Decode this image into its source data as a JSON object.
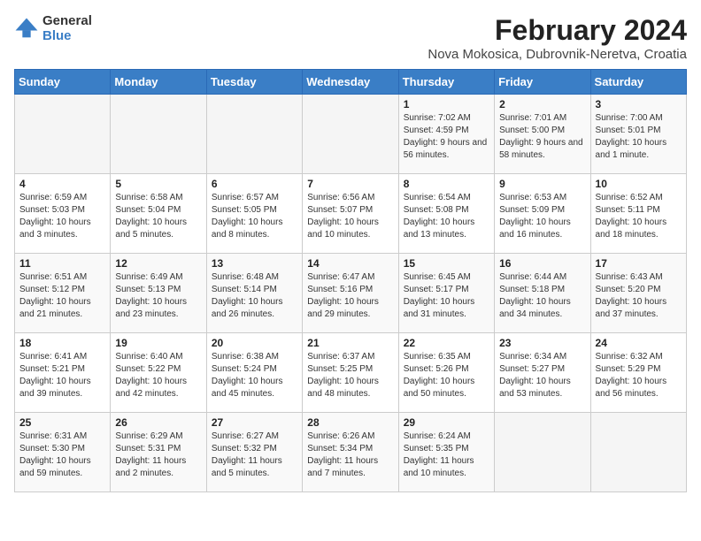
{
  "logo": {
    "general": "General",
    "blue": "Blue"
  },
  "title": "February 2024",
  "subtitle": "Nova Mokosica, Dubrovnik-Neretva, Croatia",
  "headers": [
    "Sunday",
    "Monday",
    "Tuesday",
    "Wednesday",
    "Thursday",
    "Friday",
    "Saturday"
  ],
  "rows": [
    [
      {
        "day": "",
        "info": ""
      },
      {
        "day": "",
        "info": ""
      },
      {
        "day": "",
        "info": ""
      },
      {
        "day": "",
        "info": ""
      },
      {
        "day": "1",
        "info": "Sunrise: 7:02 AM\nSunset: 4:59 PM\nDaylight: 9 hours and 56 minutes."
      },
      {
        "day": "2",
        "info": "Sunrise: 7:01 AM\nSunset: 5:00 PM\nDaylight: 9 hours and 58 minutes."
      },
      {
        "day": "3",
        "info": "Sunrise: 7:00 AM\nSunset: 5:01 PM\nDaylight: 10 hours and 1 minute."
      }
    ],
    [
      {
        "day": "4",
        "info": "Sunrise: 6:59 AM\nSunset: 5:03 PM\nDaylight: 10 hours and 3 minutes."
      },
      {
        "day": "5",
        "info": "Sunrise: 6:58 AM\nSunset: 5:04 PM\nDaylight: 10 hours and 5 minutes."
      },
      {
        "day": "6",
        "info": "Sunrise: 6:57 AM\nSunset: 5:05 PM\nDaylight: 10 hours and 8 minutes."
      },
      {
        "day": "7",
        "info": "Sunrise: 6:56 AM\nSunset: 5:07 PM\nDaylight: 10 hours and 10 minutes."
      },
      {
        "day": "8",
        "info": "Sunrise: 6:54 AM\nSunset: 5:08 PM\nDaylight: 10 hours and 13 minutes."
      },
      {
        "day": "9",
        "info": "Sunrise: 6:53 AM\nSunset: 5:09 PM\nDaylight: 10 hours and 16 minutes."
      },
      {
        "day": "10",
        "info": "Sunrise: 6:52 AM\nSunset: 5:11 PM\nDaylight: 10 hours and 18 minutes."
      }
    ],
    [
      {
        "day": "11",
        "info": "Sunrise: 6:51 AM\nSunset: 5:12 PM\nDaylight: 10 hours and 21 minutes."
      },
      {
        "day": "12",
        "info": "Sunrise: 6:49 AM\nSunset: 5:13 PM\nDaylight: 10 hours and 23 minutes."
      },
      {
        "day": "13",
        "info": "Sunrise: 6:48 AM\nSunset: 5:14 PM\nDaylight: 10 hours and 26 minutes."
      },
      {
        "day": "14",
        "info": "Sunrise: 6:47 AM\nSunset: 5:16 PM\nDaylight: 10 hours and 29 minutes."
      },
      {
        "day": "15",
        "info": "Sunrise: 6:45 AM\nSunset: 5:17 PM\nDaylight: 10 hours and 31 minutes."
      },
      {
        "day": "16",
        "info": "Sunrise: 6:44 AM\nSunset: 5:18 PM\nDaylight: 10 hours and 34 minutes."
      },
      {
        "day": "17",
        "info": "Sunrise: 6:43 AM\nSunset: 5:20 PM\nDaylight: 10 hours and 37 minutes."
      }
    ],
    [
      {
        "day": "18",
        "info": "Sunrise: 6:41 AM\nSunset: 5:21 PM\nDaylight: 10 hours and 39 minutes."
      },
      {
        "day": "19",
        "info": "Sunrise: 6:40 AM\nSunset: 5:22 PM\nDaylight: 10 hours and 42 minutes."
      },
      {
        "day": "20",
        "info": "Sunrise: 6:38 AM\nSunset: 5:24 PM\nDaylight: 10 hours and 45 minutes."
      },
      {
        "day": "21",
        "info": "Sunrise: 6:37 AM\nSunset: 5:25 PM\nDaylight: 10 hours and 48 minutes."
      },
      {
        "day": "22",
        "info": "Sunrise: 6:35 AM\nSunset: 5:26 PM\nDaylight: 10 hours and 50 minutes."
      },
      {
        "day": "23",
        "info": "Sunrise: 6:34 AM\nSunset: 5:27 PM\nDaylight: 10 hours and 53 minutes."
      },
      {
        "day": "24",
        "info": "Sunrise: 6:32 AM\nSunset: 5:29 PM\nDaylight: 10 hours and 56 minutes."
      }
    ],
    [
      {
        "day": "25",
        "info": "Sunrise: 6:31 AM\nSunset: 5:30 PM\nDaylight: 10 hours and 59 minutes."
      },
      {
        "day": "26",
        "info": "Sunrise: 6:29 AM\nSunset: 5:31 PM\nDaylight: 11 hours and 2 minutes."
      },
      {
        "day": "27",
        "info": "Sunrise: 6:27 AM\nSunset: 5:32 PM\nDaylight: 11 hours and 5 minutes."
      },
      {
        "day": "28",
        "info": "Sunrise: 6:26 AM\nSunset: 5:34 PM\nDaylight: 11 hours and 7 minutes."
      },
      {
        "day": "29",
        "info": "Sunrise: 6:24 AM\nSunset: 5:35 PM\nDaylight: 11 hours and 10 minutes."
      },
      {
        "day": "",
        "info": ""
      },
      {
        "day": "",
        "info": ""
      }
    ]
  ]
}
